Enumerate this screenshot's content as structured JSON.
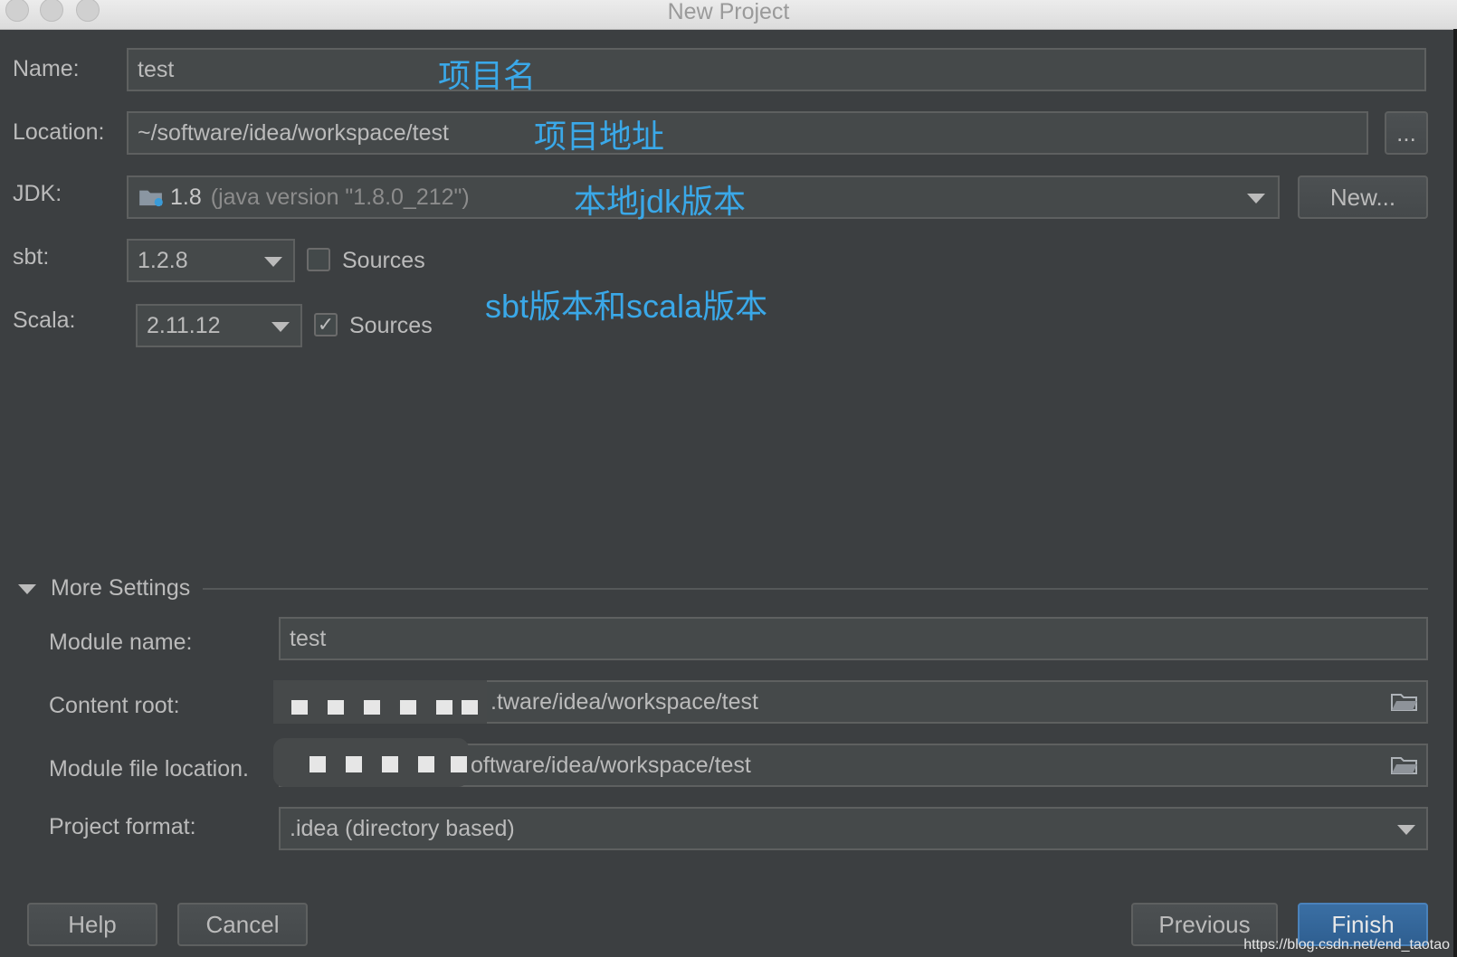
{
  "window": {
    "title": "New Project"
  },
  "name": {
    "label": "Name:",
    "value": "test",
    "annotation": "项目名"
  },
  "location": {
    "label": "Location:",
    "value": "~/software/idea/workspace/test",
    "annotation": "项目地址",
    "browse_label": "..."
  },
  "jdk": {
    "label": "JDK:",
    "version": "1.8",
    "detail": "(java version \"1.8.0_212\")",
    "annotation": "本地jdk版本",
    "new_label": "New..."
  },
  "sbt": {
    "label": "sbt:",
    "version": "1.2.8",
    "sources_label": "Sources",
    "sources_checked": false
  },
  "scala": {
    "label": "Scala:",
    "version": "2.11.12",
    "sources_label": "Sources",
    "sources_checked": true,
    "annotation": "sbt版本和scala版本"
  },
  "more_settings": {
    "label": "More Settings",
    "module_name": {
      "label": "Module name:",
      "value": "test"
    },
    "content_root": {
      "label": "Content root:",
      "value": ".tware/idea/workspace/test"
    },
    "module_file_location": {
      "label": "Module file location.",
      "value": "oftware/idea/workspace/test"
    },
    "project_format": {
      "label": "Project format:",
      "value": ".idea (directory based)"
    }
  },
  "buttons": {
    "help": "Help",
    "cancel": "Cancel",
    "previous": "Previous",
    "finish": "Finish"
  },
  "watermark": "https://blog.csdn.net/end_taotao"
}
